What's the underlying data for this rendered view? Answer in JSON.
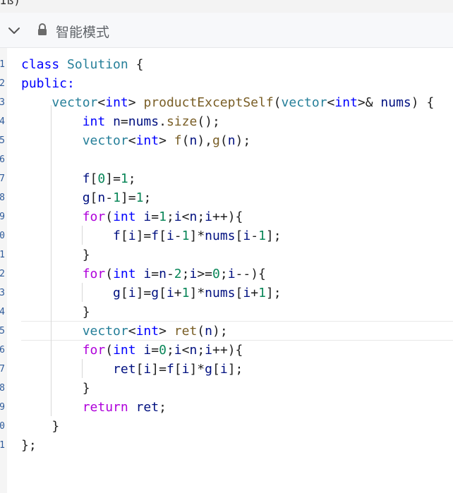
{
  "window": {
    "top_fragment": "Iß)"
  },
  "toolbar": {
    "collapse_icon": "chevron-down-icon",
    "lock_icon": "lock-icon",
    "mode_label": "智能模式"
  },
  "editor": {
    "gutter_numbers": [
      "1",
      "2",
      "3",
      "4",
      "5",
      "6",
      "7",
      "8",
      "9",
      "0",
      "1",
      "2",
      "3",
      "4",
      "5",
      "6",
      "7",
      "8",
      "9",
      "0",
      "1"
    ],
    "lines": [
      [
        [
          "kw",
          "class "
        ],
        [
          "ty",
          "Solution"
        ],
        [
          "pl",
          " {"
        ]
      ],
      [
        [
          "kw",
          "public:"
        ]
      ],
      [
        [
          "pl",
          "    "
        ],
        [
          "ty",
          "vector"
        ],
        [
          "pl",
          "<"
        ],
        [
          "kw",
          "int"
        ],
        [
          "pl",
          "> "
        ],
        [
          "fn",
          "productExceptSelf"
        ],
        [
          "pl",
          "("
        ],
        [
          "ty",
          "vector"
        ],
        [
          "pl",
          "<"
        ],
        [
          "kw",
          "int"
        ],
        [
          "pl",
          ">& "
        ],
        [
          "id",
          "nums"
        ],
        [
          "pl",
          ") {"
        ]
      ],
      [
        [
          "pl",
          "        "
        ],
        [
          "kw",
          "int"
        ],
        [
          "pl",
          " "
        ],
        [
          "id",
          "n"
        ],
        [
          "pl",
          "="
        ],
        [
          "id",
          "nums"
        ],
        [
          "pl",
          "."
        ],
        [
          "fn",
          "size"
        ],
        [
          "pl",
          "();"
        ]
      ],
      [
        [
          "pl",
          "        "
        ],
        [
          "ty",
          "vector"
        ],
        [
          "pl",
          "<"
        ],
        [
          "kw",
          "int"
        ],
        [
          "pl",
          "> "
        ],
        [
          "fn",
          "f"
        ],
        [
          "pl",
          "("
        ],
        [
          "id",
          "n"
        ],
        [
          "pl",
          "),"
        ],
        [
          "fn",
          "g"
        ],
        [
          "pl",
          "("
        ],
        [
          "id",
          "n"
        ],
        [
          "pl",
          ");"
        ]
      ],
      [
        [
          "pl",
          ""
        ]
      ],
      [
        [
          "pl",
          "        "
        ],
        [
          "id",
          "f"
        ],
        [
          "pl",
          "["
        ],
        [
          "num",
          "0"
        ],
        [
          "pl",
          "]="
        ],
        [
          "num",
          "1"
        ],
        [
          "pl",
          ";"
        ]
      ],
      [
        [
          "pl",
          "        "
        ],
        [
          "id",
          "g"
        ],
        [
          "pl",
          "["
        ],
        [
          "id",
          "n"
        ],
        [
          "pl",
          "-"
        ],
        [
          "num",
          "1"
        ],
        [
          "pl",
          "]="
        ],
        [
          "num",
          "1"
        ],
        [
          "pl",
          ";"
        ]
      ],
      [
        [
          "pl",
          "        "
        ],
        [
          "ctl",
          "for"
        ],
        [
          "pl",
          "("
        ],
        [
          "kw",
          "int"
        ],
        [
          "pl",
          " "
        ],
        [
          "id",
          "i"
        ],
        [
          "pl",
          "="
        ],
        [
          "num",
          "1"
        ],
        [
          "pl",
          ";"
        ],
        [
          "id",
          "i"
        ],
        [
          "pl",
          "<"
        ],
        [
          "id",
          "n"
        ],
        [
          "pl",
          ";"
        ],
        [
          "id",
          "i"
        ],
        [
          "pl",
          "++){"
        ]
      ],
      [
        [
          "pl",
          "            "
        ],
        [
          "id",
          "f"
        ],
        [
          "pl",
          "["
        ],
        [
          "id",
          "i"
        ],
        [
          "pl",
          "]="
        ],
        [
          "id",
          "f"
        ],
        [
          "pl",
          "["
        ],
        [
          "id",
          "i"
        ],
        [
          "pl",
          "-"
        ],
        [
          "num",
          "1"
        ],
        [
          "pl",
          "]*"
        ],
        [
          "id",
          "nums"
        ],
        [
          "pl",
          "["
        ],
        [
          "id",
          "i"
        ],
        [
          "pl",
          "-"
        ],
        [
          "num",
          "1"
        ],
        [
          "pl",
          "];"
        ]
      ],
      [
        [
          "pl",
          "        }"
        ]
      ],
      [
        [
          "pl",
          "        "
        ],
        [
          "ctl",
          "for"
        ],
        [
          "pl",
          "("
        ],
        [
          "kw",
          "int"
        ],
        [
          "pl",
          " "
        ],
        [
          "id",
          "i"
        ],
        [
          "pl",
          "="
        ],
        [
          "id",
          "n"
        ],
        [
          "pl",
          "-"
        ],
        [
          "num",
          "2"
        ],
        [
          "pl",
          ";"
        ],
        [
          "id",
          "i"
        ],
        [
          "pl",
          ">="
        ],
        [
          "num",
          "0"
        ],
        [
          "pl",
          ";"
        ],
        [
          "id",
          "i"
        ],
        [
          "pl",
          "--){"
        ]
      ],
      [
        [
          "pl",
          "            "
        ],
        [
          "id",
          "g"
        ],
        [
          "pl",
          "["
        ],
        [
          "id",
          "i"
        ],
        [
          "pl",
          "]="
        ],
        [
          "id",
          "g"
        ],
        [
          "pl",
          "["
        ],
        [
          "id",
          "i"
        ],
        [
          "pl",
          "+"
        ],
        [
          "num",
          "1"
        ],
        [
          "pl",
          "]*"
        ],
        [
          "id",
          "nums"
        ],
        [
          "pl",
          "["
        ],
        [
          "id",
          "i"
        ],
        [
          "pl",
          "+"
        ],
        [
          "num",
          "1"
        ],
        [
          "pl",
          "];"
        ]
      ],
      [
        [
          "pl",
          "        }"
        ]
      ],
      [
        [
          "pl",
          "        "
        ],
        [
          "ty",
          "vector"
        ],
        [
          "pl",
          "<"
        ],
        [
          "kw",
          "int"
        ],
        [
          "pl",
          "> "
        ],
        [
          "fn",
          "ret"
        ],
        [
          "pl",
          "("
        ],
        [
          "id",
          "n"
        ],
        [
          "pl",
          ");"
        ]
      ],
      [
        [
          "pl",
          "        "
        ],
        [
          "ctl",
          "for"
        ],
        [
          "pl",
          "("
        ],
        [
          "kw",
          "int"
        ],
        [
          "pl",
          " "
        ],
        [
          "id",
          "i"
        ],
        [
          "pl",
          "="
        ],
        [
          "num",
          "0"
        ],
        [
          "pl",
          ";"
        ],
        [
          "id",
          "i"
        ],
        [
          "pl",
          "<"
        ],
        [
          "id",
          "n"
        ],
        [
          "pl",
          ";"
        ],
        [
          "id",
          "i"
        ],
        [
          "pl",
          "++){"
        ]
      ],
      [
        [
          "pl",
          "            "
        ],
        [
          "id",
          "ret"
        ],
        [
          "pl",
          "["
        ],
        [
          "id",
          "i"
        ],
        [
          "pl",
          "]="
        ],
        [
          "id",
          "f"
        ],
        [
          "pl",
          "["
        ],
        [
          "id",
          "i"
        ],
        [
          "pl",
          "]*"
        ],
        [
          "id",
          "g"
        ],
        [
          "pl",
          "["
        ],
        [
          "id",
          "i"
        ],
        [
          "pl",
          "];"
        ]
      ],
      [
        [
          "pl",
          "        }"
        ]
      ],
      [
        [
          "pl",
          "        "
        ],
        [
          "ctl",
          "return"
        ],
        [
          "pl",
          " "
        ],
        [
          "id",
          "ret"
        ],
        [
          "pl",
          ";"
        ]
      ],
      [
        [
          "pl",
          "    }"
        ]
      ],
      [
        [
          "pl",
          "};"
        ]
      ]
    ]
  }
}
